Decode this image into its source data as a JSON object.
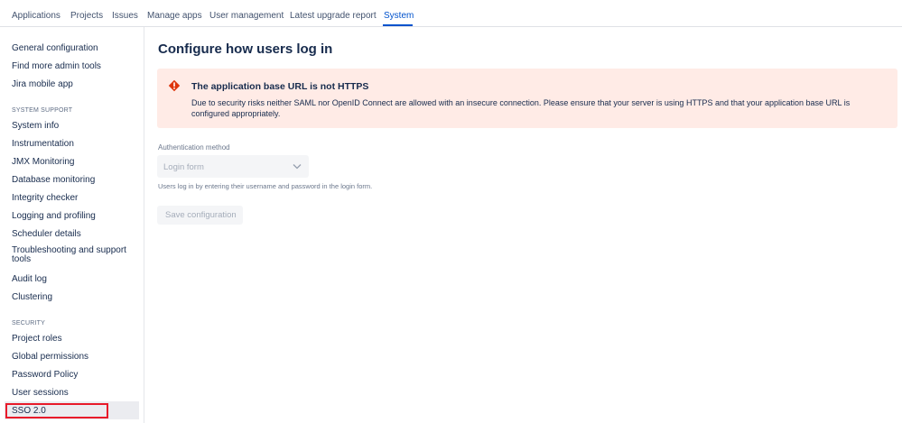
{
  "topnav": {
    "tabs": [
      {
        "label": "Applications"
      },
      {
        "label": "Projects"
      },
      {
        "label": "Issues"
      },
      {
        "label": "Manage apps"
      },
      {
        "label": "User management"
      },
      {
        "label": "Latest upgrade report"
      },
      {
        "label": "System",
        "active": true
      }
    ]
  },
  "sidebar": {
    "items_top": [
      "General configuration",
      "Find more admin tools",
      "Jira mobile app"
    ],
    "system_support_heading": "SYSTEM SUPPORT",
    "system_support_items": [
      "System info",
      "Instrumentation",
      "JMX Monitoring",
      "Database monitoring",
      "Integrity checker",
      "Logging and profiling",
      "Scheduler details",
      "Troubleshooting and support tools",
      "Audit log",
      "Clustering"
    ],
    "security_heading": "SECURITY",
    "security_items": [
      "Project roles",
      "Global permissions",
      "Password Policy",
      "User sessions",
      "SSO 2.0"
    ],
    "selected_item": "SSO 2.0"
  },
  "main": {
    "title": "Configure how users log in",
    "alert": {
      "icon": "error-icon",
      "title": "The application base URL is not HTTPS",
      "body": "Due to security risks neither SAML nor OpenID Connect are allowed with an insecure connection. Please ensure that your server is using HTTPS and that your application base URL is configured appropriately."
    },
    "auth_method_label": "Authentication method",
    "auth_method_value": "Login form",
    "help_text": "Users log in by entering their username and password in the login form.",
    "save_label": "Save configuration"
  },
  "colors": {
    "accent": "#0052cc",
    "alert_bg": "#ffebe6",
    "error": "#de350b",
    "highlight_outline": "#e81a2a"
  }
}
